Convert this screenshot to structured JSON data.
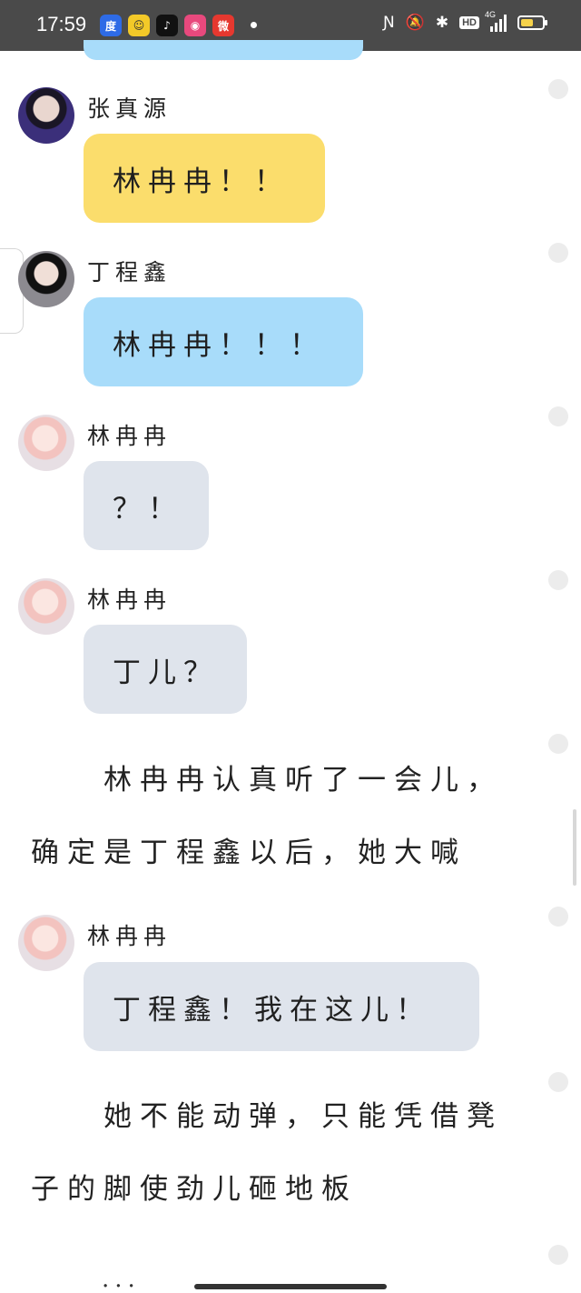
{
  "status_bar": {
    "time": "17:59",
    "apps": [
      {
        "icon": "baidu-icon",
        "glyph": "度",
        "color": "#2e6be6"
      },
      {
        "icon": "yellow-app-icon",
        "glyph": "☺",
        "color": "#f3c928"
      },
      {
        "icon": "tiktok-icon",
        "glyph": "♪",
        "color": "#111111"
      },
      {
        "icon": "pink-app-icon",
        "glyph": "◉",
        "color": "#e8497d"
      },
      {
        "icon": "weibo-icon",
        "glyph": "微",
        "color": "#e6382f"
      }
    ],
    "network": "4G",
    "hd": "HD",
    "battery_level": 0.6
  },
  "messages": [
    {
      "sender": "张真源",
      "text": "林冉冉！！"
    },
    {
      "sender": "丁程鑫",
      "text": "林冉冉！！！"
    },
    {
      "sender": "林冉冉",
      "text": "？！"
    },
    {
      "sender": "林冉冉",
      "text": "丁儿？"
    },
    {
      "narration": [
        "林冉冉认真听了一会儿，",
        "确定是丁程鑫以后，她大喊"
      ]
    },
    {
      "sender": "林冉冉",
      "text": "丁程鑫！我在这儿！"
    },
    {
      "narration": [
        "她不能动弹，只能凭借凳",
        "子的脚使劲儿砸地板"
      ]
    }
  ],
  "ellipsis": "..."
}
